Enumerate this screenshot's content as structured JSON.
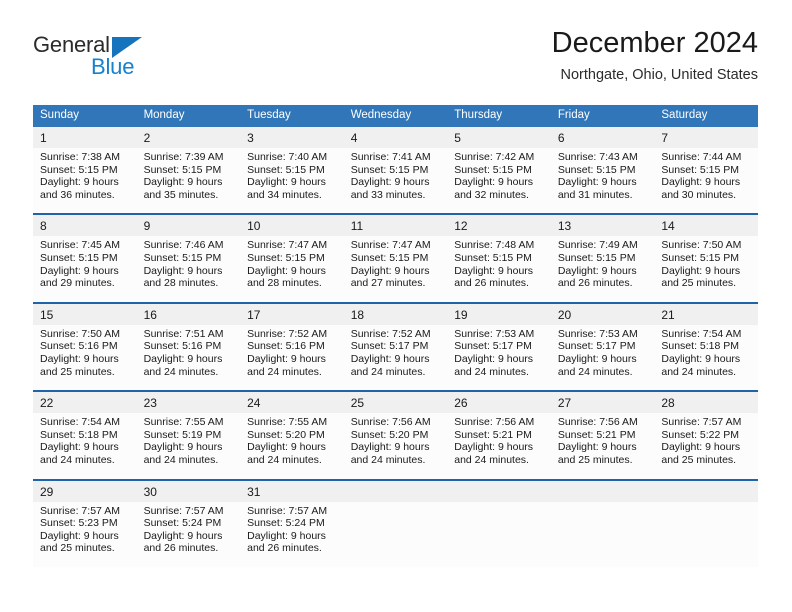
{
  "brand": {
    "name_part1": "General",
    "name_part2": "Blue",
    "triangle_color": "#1574bd",
    "blue_text_color": "#1681cf"
  },
  "header": {
    "title": "December 2024",
    "subtitle": "Northgate, Ohio, United States"
  },
  "theme": {
    "header_blue": "#3176b8",
    "separator_blue": "#1f64a8",
    "date_band": "#f0f0f0",
    "cell_bg": "#fcfcfc"
  },
  "weekday_headers": [
    "Sunday",
    "Monday",
    "Tuesday",
    "Wednesday",
    "Thursday",
    "Friday",
    "Saturday"
  ],
  "weeks": [
    {
      "days": [
        {
          "date": "1",
          "sunrise": "Sunrise: 7:38 AM",
          "sunset": "Sunset: 5:15 PM",
          "daylight_1": "Daylight: 9 hours",
          "daylight_2": "and 36 minutes."
        },
        {
          "date": "2",
          "sunrise": "Sunrise: 7:39 AM",
          "sunset": "Sunset: 5:15 PM",
          "daylight_1": "Daylight: 9 hours",
          "daylight_2": "and 35 minutes."
        },
        {
          "date": "3",
          "sunrise": "Sunrise: 7:40 AM",
          "sunset": "Sunset: 5:15 PM",
          "daylight_1": "Daylight: 9 hours",
          "daylight_2": "and 34 minutes."
        },
        {
          "date": "4",
          "sunrise": "Sunrise: 7:41 AM",
          "sunset": "Sunset: 5:15 PM",
          "daylight_1": "Daylight: 9 hours",
          "daylight_2": "and 33 minutes."
        },
        {
          "date": "5",
          "sunrise": "Sunrise: 7:42 AM",
          "sunset": "Sunset: 5:15 PM",
          "daylight_1": "Daylight: 9 hours",
          "daylight_2": "and 32 minutes."
        },
        {
          "date": "6",
          "sunrise": "Sunrise: 7:43 AM",
          "sunset": "Sunset: 5:15 PM",
          "daylight_1": "Daylight: 9 hours",
          "daylight_2": "and 31 minutes."
        },
        {
          "date": "7",
          "sunrise": "Sunrise: 7:44 AM",
          "sunset": "Sunset: 5:15 PM",
          "daylight_1": "Daylight: 9 hours",
          "daylight_2": "and 30 minutes."
        }
      ]
    },
    {
      "days": [
        {
          "date": "8",
          "sunrise": "Sunrise: 7:45 AM",
          "sunset": "Sunset: 5:15 PM",
          "daylight_1": "Daylight: 9 hours",
          "daylight_2": "and 29 minutes."
        },
        {
          "date": "9",
          "sunrise": "Sunrise: 7:46 AM",
          "sunset": "Sunset: 5:15 PM",
          "daylight_1": "Daylight: 9 hours",
          "daylight_2": "and 28 minutes."
        },
        {
          "date": "10",
          "sunrise": "Sunrise: 7:47 AM",
          "sunset": "Sunset: 5:15 PM",
          "daylight_1": "Daylight: 9 hours",
          "daylight_2": "and 28 minutes."
        },
        {
          "date": "11",
          "sunrise": "Sunrise: 7:47 AM",
          "sunset": "Sunset: 5:15 PM",
          "daylight_1": "Daylight: 9 hours",
          "daylight_2": "and 27 minutes."
        },
        {
          "date": "12",
          "sunrise": "Sunrise: 7:48 AM",
          "sunset": "Sunset: 5:15 PM",
          "daylight_1": "Daylight: 9 hours",
          "daylight_2": "and 26 minutes."
        },
        {
          "date": "13",
          "sunrise": "Sunrise: 7:49 AM",
          "sunset": "Sunset: 5:15 PM",
          "daylight_1": "Daylight: 9 hours",
          "daylight_2": "and 26 minutes."
        },
        {
          "date": "14",
          "sunrise": "Sunrise: 7:50 AM",
          "sunset": "Sunset: 5:15 PM",
          "daylight_1": "Daylight: 9 hours",
          "daylight_2": "and 25 minutes."
        }
      ]
    },
    {
      "days": [
        {
          "date": "15",
          "sunrise": "Sunrise: 7:50 AM",
          "sunset": "Sunset: 5:16 PM",
          "daylight_1": "Daylight: 9 hours",
          "daylight_2": "and 25 minutes."
        },
        {
          "date": "16",
          "sunrise": "Sunrise: 7:51 AM",
          "sunset": "Sunset: 5:16 PM",
          "daylight_1": "Daylight: 9 hours",
          "daylight_2": "and 24 minutes."
        },
        {
          "date": "17",
          "sunrise": "Sunrise: 7:52 AM",
          "sunset": "Sunset: 5:16 PM",
          "daylight_1": "Daylight: 9 hours",
          "daylight_2": "and 24 minutes."
        },
        {
          "date": "18",
          "sunrise": "Sunrise: 7:52 AM",
          "sunset": "Sunset: 5:17 PM",
          "daylight_1": "Daylight: 9 hours",
          "daylight_2": "and 24 minutes."
        },
        {
          "date": "19",
          "sunrise": "Sunrise: 7:53 AM",
          "sunset": "Sunset: 5:17 PM",
          "daylight_1": "Daylight: 9 hours",
          "daylight_2": "and 24 minutes."
        },
        {
          "date": "20",
          "sunrise": "Sunrise: 7:53 AM",
          "sunset": "Sunset: 5:17 PM",
          "daylight_1": "Daylight: 9 hours",
          "daylight_2": "and 24 minutes."
        },
        {
          "date": "21",
          "sunrise": "Sunrise: 7:54 AM",
          "sunset": "Sunset: 5:18 PM",
          "daylight_1": "Daylight: 9 hours",
          "daylight_2": "and 24 minutes."
        }
      ]
    },
    {
      "days": [
        {
          "date": "22",
          "sunrise": "Sunrise: 7:54 AM",
          "sunset": "Sunset: 5:18 PM",
          "daylight_1": "Daylight: 9 hours",
          "daylight_2": "and 24 minutes."
        },
        {
          "date": "23",
          "sunrise": "Sunrise: 7:55 AM",
          "sunset": "Sunset: 5:19 PM",
          "daylight_1": "Daylight: 9 hours",
          "daylight_2": "and 24 minutes."
        },
        {
          "date": "24",
          "sunrise": "Sunrise: 7:55 AM",
          "sunset": "Sunset: 5:20 PM",
          "daylight_1": "Daylight: 9 hours",
          "daylight_2": "and 24 minutes."
        },
        {
          "date": "25",
          "sunrise": "Sunrise: 7:56 AM",
          "sunset": "Sunset: 5:20 PM",
          "daylight_1": "Daylight: 9 hours",
          "daylight_2": "and 24 minutes."
        },
        {
          "date": "26",
          "sunrise": "Sunrise: 7:56 AM",
          "sunset": "Sunset: 5:21 PM",
          "daylight_1": "Daylight: 9 hours",
          "daylight_2": "and 24 minutes."
        },
        {
          "date": "27",
          "sunrise": "Sunrise: 7:56 AM",
          "sunset": "Sunset: 5:21 PM",
          "daylight_1": "Daylight: 9 hours",
          "daylight_2": "and 25 minutes."
        },
        {
          "date": "28",
          "sunrise": "Sunrise: 7:57 AM",
          "sunset": "Sunset: 5:22 PM",
          "daylight_1": "Daylight: 9 hours",
          "daylight_2": "and 25 minutes."
        }
      ]
    },
    {
      "days": [
        {
          "date": "29",
          "sunrise": "Sunrise: 7:57 AM",
          "sunset": "Sunset: 5:23 PM",
          "daylight_1": "Daylight: 9 hours",
          "daylight_2": "and 25 minutes."
        },
        {
          "date": "30",
          "sunrise": "Sunrise: 7:57 AM",
          "sunset": "Sunset: 5:24 PM",
          "daylight_1": "Daylight: 9 hours",
          "daylight_2": "and 26 minutes."
        },
        {
          "date": "31",
          "sunrise": "Sunrise: 7:57 AM",
          "sunset": "Sunset: 5:24 PM",
          "daylight_1": "Daylight: 9 hours",
          "daylight_2": "and 26 minutes."
        },
        {
          "date": "",
          "sunrise": "",
          "sunset": "",
          "daylight_1": "",
          "daylight_2": ""
        },
        {
          "date": "",
          "sunrise": "",
          "sunset": "",
          "daylight_1": "",
          "daylight_2": ""
        },
        {
          "date": "",
          "sunrise": "",
          "sunset": "",
          "daylight_1": "",
          "daylight_2": ""
        },
        {
          "date": "",
          "sunrise": "",
          "sunset": "",
          "daylight_1": "",
          "daylight_2": ""
        }
      ]
    }
  ]
}
